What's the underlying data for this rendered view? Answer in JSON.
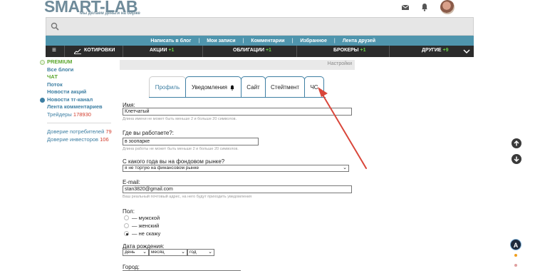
{
  "header": {
    "logo": "SMART-LAB",
    "tagline": "Мы делаем деньги на бирже"
  },
  "icons": {
    "mail": "mail-icon",
    "bell": "bell-icon",
    "search": "search-icon"
  },
  "bluenav": {
    "items": [
      "Написать в блог",
      "Мои записи",
      "Комментарии",
      "Избранное",
      "Лента друзей"
    ],
    "separator": "|"
  },
  "darknav": {
    "menu": "≡",
    "quotes": "КОТИРОВКИ",
    "stocks": "АКЦИИ",
    "stocks_count": "+1",
    "bonds": "ОБЛИГАЦИИ",
    "bonds_count": "+1",
    "brokers": "БРОКЕРЫ",
    "brokers_count": "+1",
    "other": "ДРУГИЕ",
    "other_count": "+9"
  },
  "sidebar": {
    "premium": "PREMIUM",
    "all_blogs": "Все блоги",
    "chat": "ЧАТ",
    "stream": "Поток",
    "stock_news": "Новости акций",
    "tg_news": "Новости тг-канал",
    "comments_feed": "Лента комментариев",
    "traders": "Трейдеры",
    "traders_count": "178930",
    "consumer_trust": "Доверие потребителей",
    "consumer_trust_count": "79",
    "investor_trust": "Доверие инвесторов",
    "investor_trust_count": "106"
  },
  "settings_label": "Настройки",
  "tabs": [
    "Профиль",
    "Уведомления",
    "Сайт",
    "Стейтмент",
    "ЧС"
  ],
  "form": {
    "name_label": "Имя:",
    "name_value": "Клетчатый",
    "name_hint": "Длина имени не может быть меньше 2 и больше 20 символов.",
    "work_label": "Где вы работаете?:",
    "work_value": "в зоопарке",
    "work_hint": "Длина работы не может быть меньше 2 и больше 20 символов.",
    "year_label": "С какого года вы на фондовом рынке?",
    "year_value": "я не торгую на финансовом рынке",
    "email_label": "E-mail:",
    "email_value": "stan3820@gmail.com",
    "email_hint": "Ваш реальный почтовый адрес, на него будут приходить уведомления",
    "gender_label": "Пол:",
    "gender_options": [
      "— мужской",
      "— женский",
      "— не скажу"
    ],
    "gender_selected": 2,
    "birth_label": "Дата рождения:",
    "birth_day": "день",
    "birth_month": "месяц",
    "birth_year": "год",
    "city_label": "Город:"
  },
  "floating": {
    "accessibility": "A"
  },
  "colors": {
    "link_blue": "#3e7fa3",
    "green": "#5ba62d",
    "red": "#d23b2b",
    "nav_blue": "#4f95ad",
    "nav_dark": "#2b2b2b",
    "arrow_red": "#d9463a"
  }
}
